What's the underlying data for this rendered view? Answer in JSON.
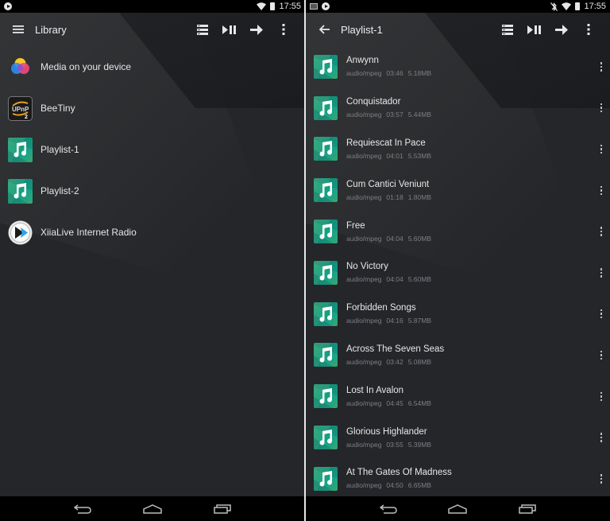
{
  "left_screen": {
    "status_bar": {
      "left_icons": [
        "play-notification-icon"
      ],
      "right_icons": [
        "wifi-icon",
        "battery-icon"
      ],
      "time": "17:55"
    },
    "app_bar": {
      "nav_icon": "menu-icon",
      "title": "Library",
      "actions": [
        "queue-icon",
        "play-pause-icon",
        "forward-arrow-icon",
        "more-vert-icon"
      ]
    },
    "items": [
      {
        "label": "Media on your device",
        "icon": "media-device-icon"
      },
      {
        "label": "BeeTiny",
        "icon": "upnp-server-icon"
      },
      {
        "label": "Playlist-1",
        "icon": "music-note-icon"
      },
      {
        "label": "Playlist-2",
        "icon": "music-note-icon"
      },
      {
        "label": "XiiaLive Internet Radio",
        "icon": "xiialive-icon"
      }
    ],
    "nav_bar": [
      "back-icon",
      "home-icon",
      "recents-icon"
    ]
  },
  "right_screen": {
    "status_bar": {
      "left_icons": [
        "screenshot-icon",
        "play-notification-icon"
      ],
      "right_icons": [
        "bluetooth-off-icon",
        "wifi-icon",
        "battery-icon"
      ],
      "time": "17:55"
    },
    "app_bar": {
      "nav_icon": "back-arrow-icon",
      "title": "Playlist-1",
      "actions": [
        "queue-icon",
        "play-pause-icon",
        "forward-arrow-icon",
        "more-vert-icon"
      ]
    },
    "tracks": [
      {
        "title": "Anwynn",
        "type": "audio/mpeg",
        "duration": "03:46",
        "size": "5.18MB"
      },
      {
        "title": "Conquistador",
        "type": "audio/mpeg",
        "duration": "03:57",
        "size": "5.44MB"
      },
      {
        "title": "Requiescat In Pace",
        "type": "audio/mpeg",
        "duration": "04:01",
        "size": "5.53MB"
      },
      {
        "title": "Cum Cantici Veniunt",
        "type": "audio/mpeg",
        "duration": "01:18",
        "size": "1.80MB"
      },
      {
        "title": "Free",
        "type": "audio/mpeg",
        "duration": "04:04",
        "size": "5.60MB"
      },
      {
        "title": "No Victory",
        "type": "audio/mpeg",
        "duration": "04:04",
        "size": "5.60MB"
      },
      {
        "title": "Forbidden Songs",
        "type": "audio/mpeg",
        "duration": "04:16",
        "size": "5.87MB"
      },
      {
        "title": "Across The Seven Seas",
        "type": "audio/mpeg",
        "duration": "03:42",
        "size": "5.08MB"
      },
      {
        "title": "Lost In Avalon",
        "type": "audio/mpeg",
        "duration": "04:45",
        "size": "6.54MB"
      },
      {
        "title": "Glorious Highlander",
        "type": "audio/mpeg",
        "duration": "03:55",
        "size": "5.39MB"
      },
      {
        "title": "At The Gates Of Madness",
        "type": "audio/mpeg",
        "duration": "04:50",
        "size": "6.65MB"
      }
    ],
    "nav_bar": [
      "back-icon",
      "home-icon",
      "recents-icon"
    ]
  },
  "colors": {
    "background": "#24262a",
    "status_bar": "#000000",
    "primary_text": "#e6e6e6",
    "secondary_text": "#7c7f84",
    "music_tile": "#1aa07a"
  }
}
